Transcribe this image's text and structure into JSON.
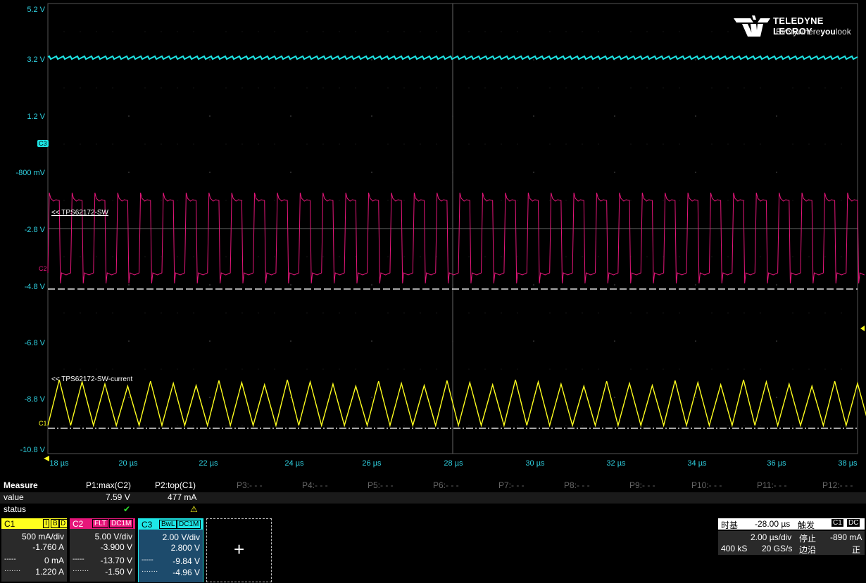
{
  "colors": {
    "c1": "#ffff1e",
    "c2": "#e6167a",
    "c3": "#1ee6e6",
    "grid": "#555555",
    "axis_text": "#2fd0e0"
  },
  "brand": {
    "name": "TELEDYNE LECROY",
    "tagline_a": "Everywhere",
    "tagline_b": "you",
    "tagline_c": "look",
    "icon": "teledyne-logo-icon"
  },
  "y_labels": [
    "5.2 V",
    "3.2 V",
    "1.2 V",
    "-800 mV",
    "-2.8 V",
    "-4.8 V",
    "-6.8 V",
    "-8.8 V",
    "-10.8 V"
  ],
  "x_labels": [
    "18 µs",
    "20 µs",
    "22 µs",
    "24 µs",
    "26 µs",
    "28 µs",
    "30 µs",
    "32 µs",
    "34 µs",
    "36 µs",
    "38 µs"
  ],
  "markers": {
    "c3": "C3",
    "c2": "C2",
    "c1": "C1"
  },
  "trace_labels": {
    "sw": "<< TPS62172-SW",
    "current": "<< TPS62172-SW-current"
  },
  "measure": {
    "title": "Measure",
    "row_value": "value",
    "row_status": "status",
    "p1": {
      "name": "P1:max(C2)",
      "value": "7.59 V",
      "status": "✔"
    },
    "p2": {
      "name": "P2:top(C1)",
      "value": "477 mA",
      "status": "⚠"
    },
    "empty": [
      "P3:- - -",
      "P4:- - -",
      "P5:- - -",
      "P6:- - -",
      "P7:- - -",
      "P8:- - -",
      "P9:- - -",
      "P10:- - -",
      "P11:- - -",
      "P12:- - -"
    ]
  },
  "channels": {
    "c1": {
      "name": "C1",
      "tags": [
        "I",
        "B",
        "D"
      ],
      "scale": "500 mA/div",
      "offset": "-1.760 A",
      "line3": "0 mA",
      "line4": "1.220 A"
    },
    "c2": {
      "name": "C2",
      "tags": [
        "FLT",
        "DC1M"
      ],
      "scale": "5.00 V/div",
      "offset": "-3.900 V",
      "line3": "-13.70 V",
      "line4": "-1.50 V"
    },
    "c3": {
      "name": "C3",
      "tags": [
        "BwL",
        "DC1M"
      ],
      "scale": "2.00 V/div",
      "offset": "2.800 V",
      "line3": "-9.84 V",
      "line4": "-4.96 V"
    },
    "cursor_marks": {
      "a": "-----",
      "b": "·······"
    }
  },
  "add_button": "+",
  "timebase": {
    "label": "时基",
    "delay": "-28.00 µs",
    "div": "2.00 µs/div",
    "samples": "400 kS",
    "rate": "20 GS/s",
    "trig_label": "触发",
    "trig_src": "C1",
    "trig_cpl": "DC",
    "mode": "停止",
    "level": "-890 mA",
    "edge_label": "边沿",
    "slope": "正"
  }
}
